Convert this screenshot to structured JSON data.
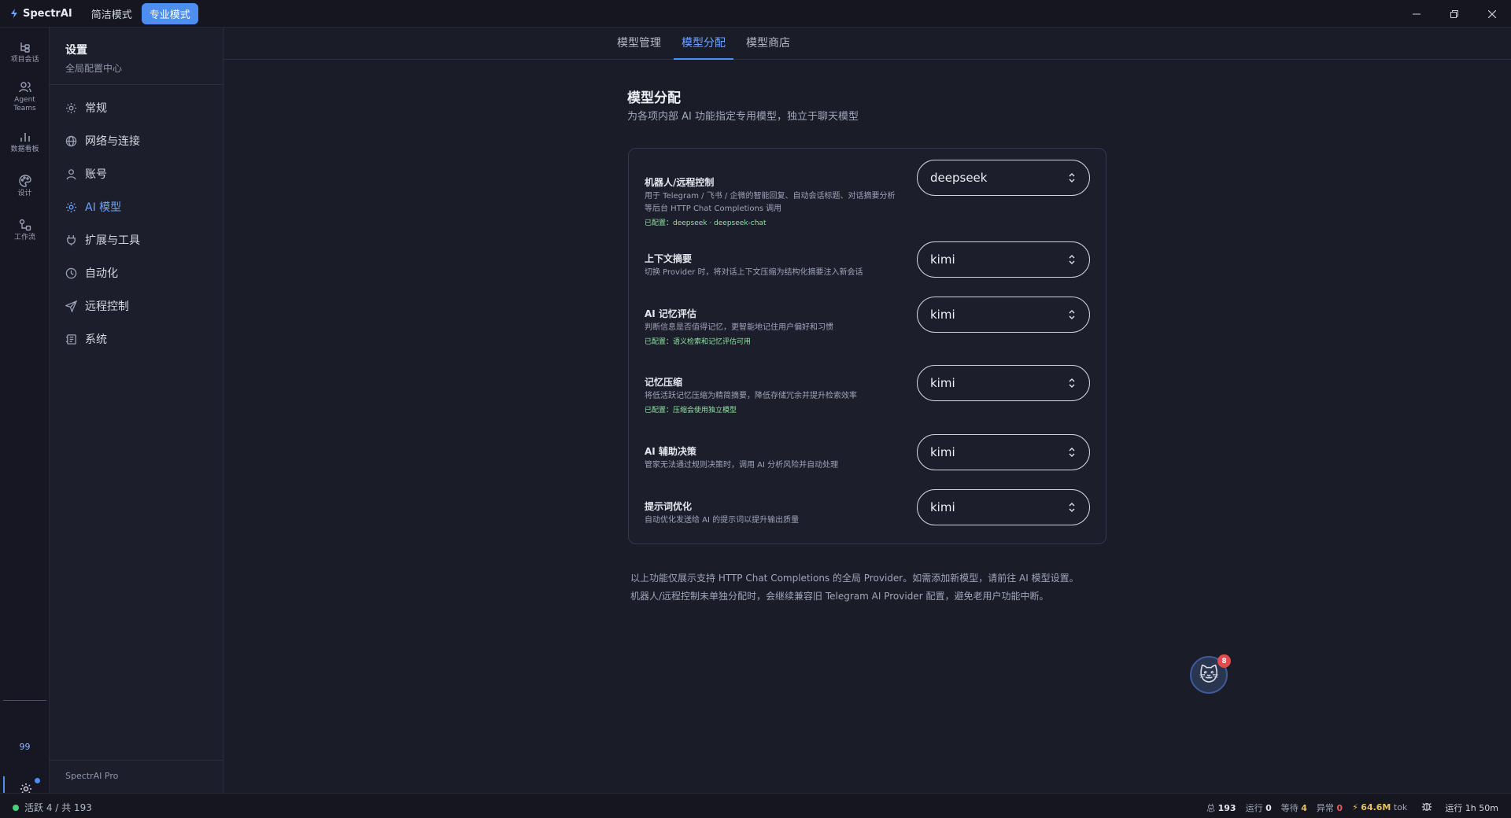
{
  "app": {
    "brand": "SpectrAI",
    "mode_simple": "简洁模式",
    "mode_pro": "专业模式"
  },
  "rail": {
    "items": [
      {
        "label": "项目会话"
      },
      {
        "label": "Agent Teams"
      },
      {
        "label": "数据看板"
      },
      {
        "label": "设计"
      },
      {
        "label": "工作流"
      }
    ],
    "count": "99",
    "settings_label": "设置"
  },
  "sidebar": {
    "title": "设置",
    "subtitle": "全局配置中心",
    "items": [
      {
        "label": "常规"
      },
      {
        "label": "网络与连接"
      },
      {
        "label": "账号"
      },
      {
        "label": "AI 模型"
      },
      {
        "label": "扩展与工具"
      },
      {
        "label": "自动化"
      },
      {
        "label": "远程控制"
      },
      {
        "label": "系统"
      }
    ],
    "footer": "SpectrAI Pro"
  },
  "tabs": [
    {
      "label": "模型管理"
    },
    {
      "label": "模型分配"
    },
    {
      "label": "模型商店"
    }
  ],
  "section": {
    "title": "模型分配",
    "subtitle": "为各项内部 AI 功能指定专用模型，独立于聊天模型"
  },
  "assignments": [
    {
      "name": "机器人/远程控制",
      "desc": "用于 Telegram / 飞书 / 企微的智能回复、自动会话标题、对话摘要分析等后台 HTTP Chat Completions 调用",
      "status": "已配置：deepseek · deepseek-chat",
      "value": "deepseek"
    },
    {
      "name": "上下文摘要",
      "desc": "切换 Provider 时，将对话上下文压缩为结构化摘要注入新会话",
      "status": "",
      "value": "kimi"
    },
    {
      "name": "AI 记忆评估",
      "desc": "判断信息是否值得记忆，更智能地记住用户偏好和习惯",
      "status": "已配置：语义检索和记忆评估可用",
      "value": "kimi"
    },
    {
      "name": "记忆压缩",
      "desc": "将低活跃记忆压缩为精简摘要，降低存储冗余并提升检索效率",
      "status": "已配置：压缩会使用独立模型",
      "value": "kimi"
    },
    {
      "name": "AI 辅助决策",
      "desc": "管家无法通过规则决策时，调用 AI 分析风险并自动处理",
      "status": "",
      "value": "kimi"
    },
    {
      "name": "提示词优化",
      "desc": "自动优化发送给 AI 的提示词以提升输出质量",
      "status": "",
      "value": "kimi"
    }
  ],
  "notes": [
    "以上功能仅展示支持 HTTP Chat Completions 的全局 Provider。如需添加新模型，请前往 AI 模型设置。",
    "机器人/远程控制未单独分配时，会继续兼容旧 Telegram AI Provider 配置，避免老用户功能中断。"
  ],
  "assistant": {
    "badge": "8",
    "icon": "cat-face-icon"
  },
  "status": {
    "active": "活跃 4 / 共 193",
    "total_label": "总",
    "total": "193",
    "running_label": "运行",
    "running": "0",
    "waiting_label": "等待",
    "waiting": "4",
    "error_label": "异常",
    "error": "0",
    "tokens": "64.6M",
    "tokens_unit": "tok",
    "uptime": "运行 1h 50m"
  },
  "colors": {
    "accent": "#4d8ef0",
    "ok": "#8ee3a0",
    "warn": "#e6c25a",
    "error": "#e65a5a"
  }
}
